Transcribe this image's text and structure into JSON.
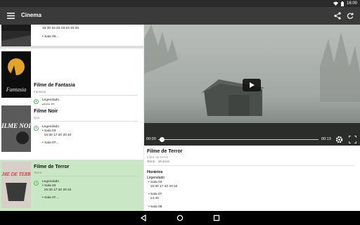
{
  "status_bar": {
    "time": "16:00"
  },
  "app_bar": {
    "title": "Cinema"
  },
  "movies": [
    {
      "title": "",
      "genre": "",
      "sessions": "15:30 15:45 18:10 20:35\n\n• Sala 06..."
    },
    {
      "title": "Filme de Fantasia",
      "genre": "Fantasia",
      "legend": "Legendado",
      "sessions": "•Sala 01\n  17:10 22:20"
    },
    {
      "title": "Filme Noir",
      "genre": "Noir",
      "legend": "Legendado",
      "sessions": "• Sala 03\n  15:30 17:40 20:10\n\n• Sala 07..."
    },
    {
      "title": "Filme de Terror",
      "genre": "Terror",
      "legend": "Legendado",
      "sessions": "• Sala 03\n  15:30 17:40 20:10\n\n• Sala 07..."
    }
  ],
  "posters": [
    {
      "text": ""
    },
    {
      "text": "Fantasia"
    },
    {
      "text": "FILME NOIR"
    },
    {
      "text": "FILME DE TERROR"
    }
  ],
  "player": {
    "current_time": "00:00",
    "duration": "00:13",
    "progress": 0.0
  },
  "detail": {
    "title": "Filme de Terror",
    "subtitle": "Filme de Terror",
    "meta": "Terror · 18 anos",
    "schedule_heading": "Horários",
    "legend": "Legendado",
    "sessions": "• Sala 03\n  15:30 17:40 20:10\n\n• Sala 07\n  14:40\n\n• Sala 08"
  },
  "colors": {
    "appbar": "#3a3a3a",
    "highlight": "#c9e7c5",
    "accent_green": "#5cb85c"
  }
}
